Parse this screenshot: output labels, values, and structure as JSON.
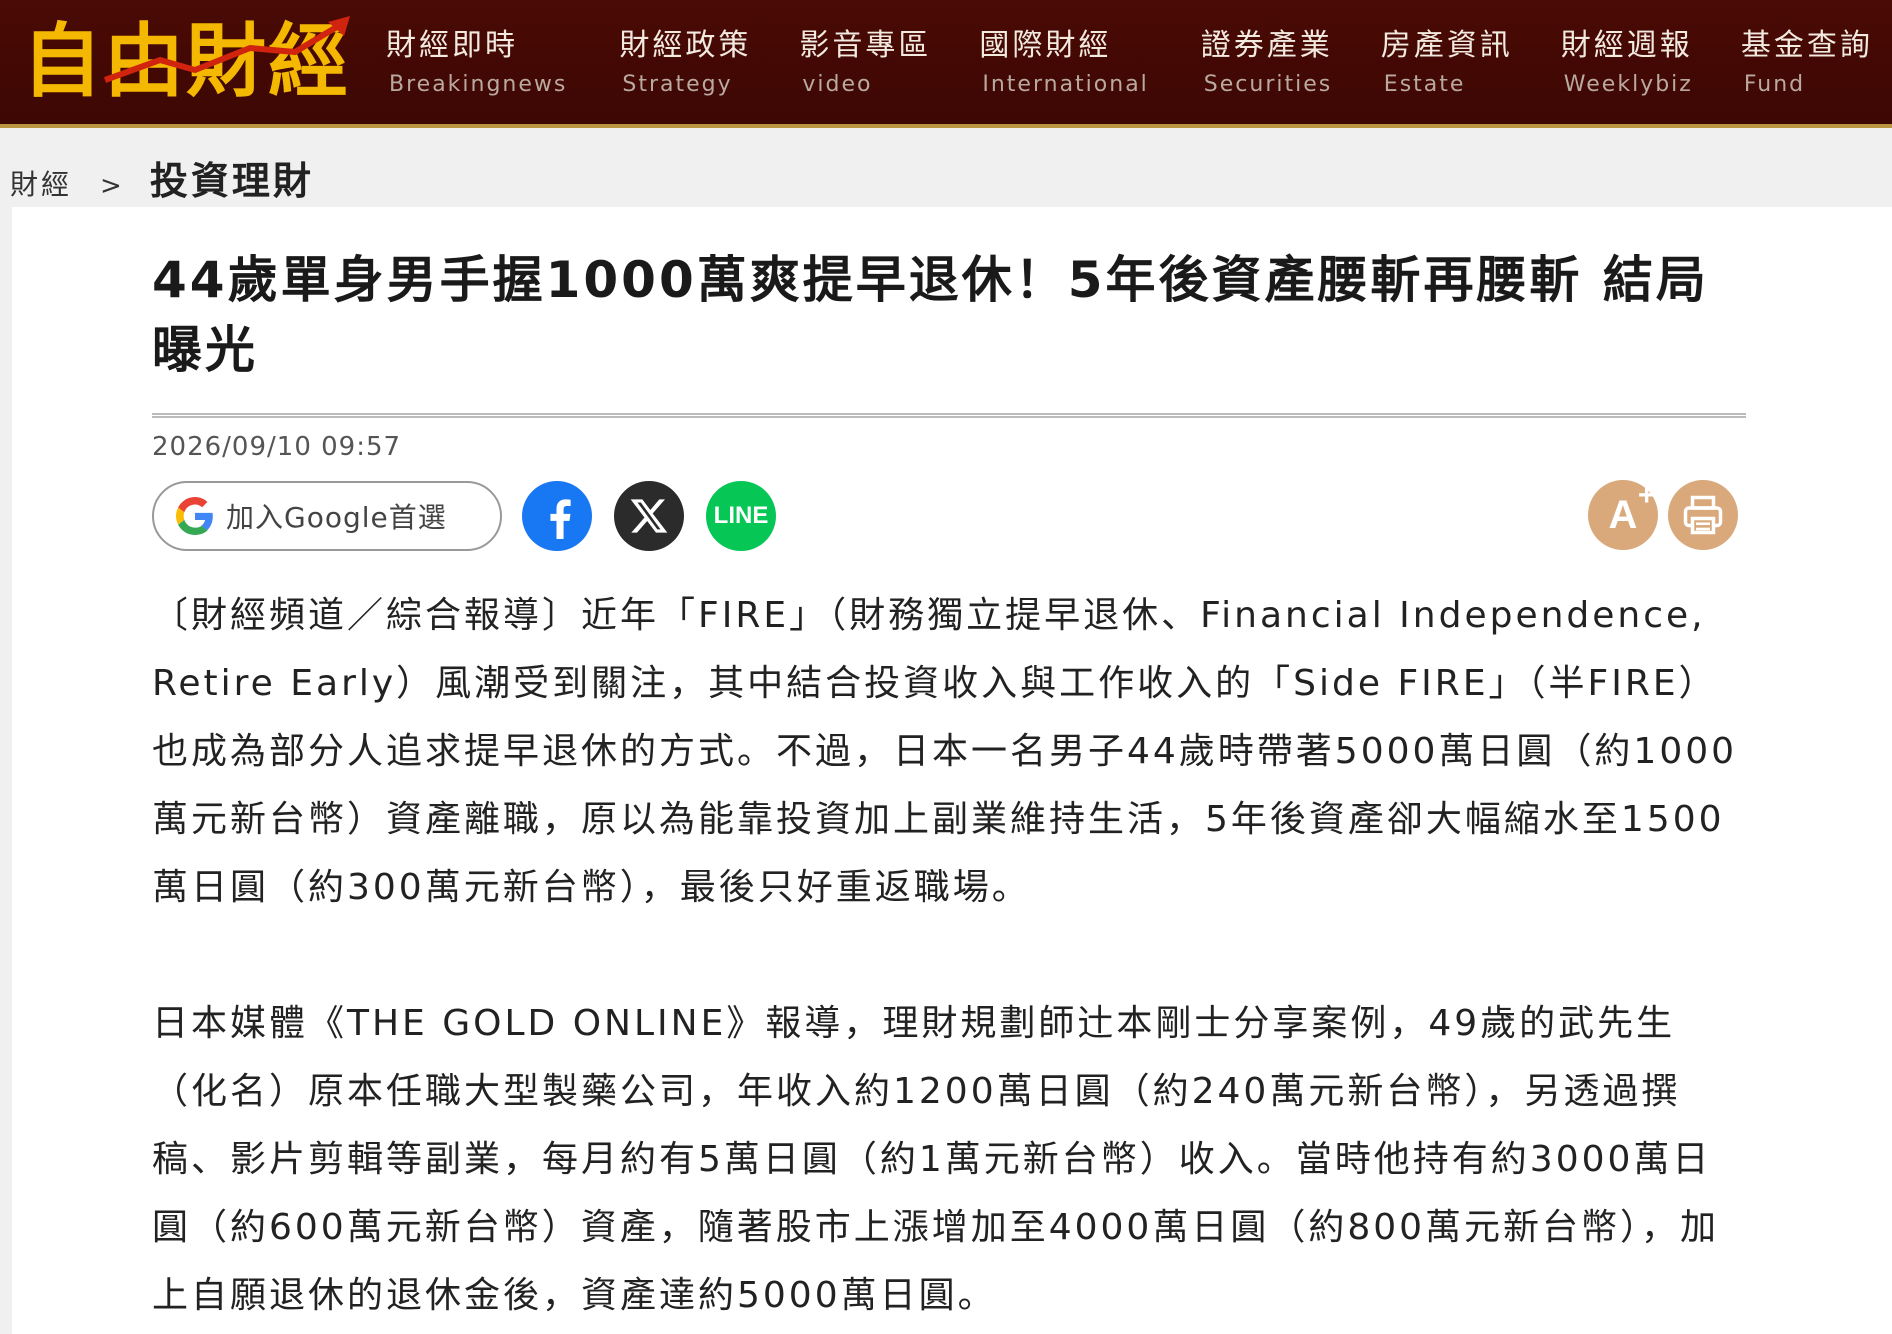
{
  "brand": {
    "logo_text": "自由財經"
  },
  "nav": [
    {
      "zh": "財經即時",
      "en": "Breakingnews"
    },
    {
      "zh": "財經政策",
      "en": "Strategy"
    },
    {
      "zh": "影音專區",
      "en": "video"
    },
    {
      "zh": "國際財經",
      "en": "International"
    },
    {
      "zh": "證券產業",
      "en": "Securities"
    },
    {
      "zh": "房產資訊",
      "en": "Estate"
    },
    {
      "zh": "財經週報",
      "en": "Weeklybiz"
    },
    {
      "zh": "基金查詢",
      "en": "Fund"
    }
  ],
  "breadcrumb": {
    "root": "財經",
    "separator": ">",
    "current": "投資理財"
  },
  "article": {
    "title": "44歲單身男手握1000萬爽提早退休！5年後資產腰斬再腰斬 結局曝光",
    "date": "2026/09/10 09:57",
    "paragraphs": [
      "〔財經頻道／綜合報導〕近年「FIRE」（財務獨立提早退休、Financial Independence, Retire Early）風潮受到關注，其中結合投資收入與工作收入的「Side FIRE」（半FIRE）也成為部分人追求提早退休的方式。不過，日本一名男子44歲時帶著5000萬日圓（約1000萬元新台幣）資產離職，原以為能靠投資加上副業維持生活，5年後資產卻大幅縮水至1500萬日圓（約300萬元新台幣），最後只好重返職場。",
      "日本媒體《THE GOLD ONLINE》報導，理財規劃師辻本剛士分享案例，49歲的武先生（化名）原本任職大型製藥公司，年收入約1200萬日圓（約240萬元新台幣），另透過撰稿、影片剪輯等副業，每月約有5萬日圓（約1萬元新台幣）收入。當時他持有約3000萬日圓（約600萬元新台幣）資產，隨著股市上漲增加至4000萬日圓（約800萬元新台幣），加上自願退休的退休金後，資產達約5000萬日圓。"
    ]
  },
  "share": {
    "google_label": "加入Google首選",
    "line_label": "LINE"
  },
  "colors": {
    "nav_bg": "#3d0703",
    "logo_gold": "#f5b800",
    "facebook": "#1877f2",
    "x": "#2b2b2b",
    "line": "#06c755",
    "tool_bg": "#d9a97c"
  },
  "icons": {
    "google": "google-g-icon",
    "facebook": "facebook-icon",
    "x": "x-icon",
    "line": "line-icon",
    "font_size": "font-size-plus-icon",
    "print": "print-icon",
    "logo_arrow": "rising-arrow-icon"
  }
}
